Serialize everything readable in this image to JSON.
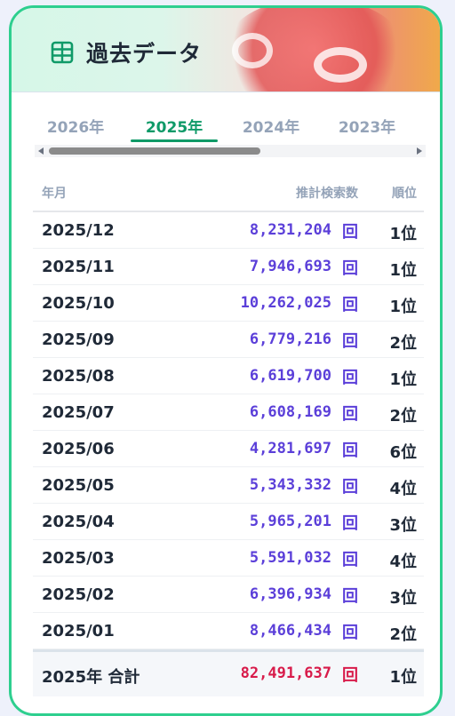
{
  "header": {
    "title": "過去データ",
    "icon": "table-icon",
    "accent": "#0f9a68",
    "border": "#2ecf8f"
  },
  "tabs": [
    {
      "label": "2026年",
      "active": false
    },
    {
      "label": "2025年",
      "active": true
    },
    {
      "label": "2024年",
      "active": false
    },
    {
      "label": "2023年",
      "active": false
    }
  ],
  "table": {
    "headers": {
      "month": "年月",
      "count": "推計検索数",
      "rank": "順位"
    },
    "unit": "回",
    "rows": [
      {
        "month": "2025/12",
        "count": "8,231,204",
        "rank": "1位"
      },
      {
        "month": "2025/11",
        "count": "7,946,693",
        "rank": "1位"
      },
      {
        "month": "2025/10",
        "count": "10,262,025",
        "rank": "1位"
      },
      {
        "month": "2025/09",
        "count": "6,779,216",
        "rank": "2位"
      },
      {
        "month": "2025/08",
        "count": "6,619,700",
        "rank": "1位"
      },
      {
        "month": "2025/07",
        "count": "6,608,169",
        "rank": "2位"
      },
      {
        "month": "2025/06",
        "count": "4,281,697",
        "rank": "6位"
      },
      {
        "month": "2025/05",
        "count": "5,343,332",
        "rank": "4位"
      },
      {
        "month": "2025/04",
        "count": "5,965,201",
        "rank": "3位"
      },
      {
        "month": "2025/03",
        "count": "5,591,032",
        "rank": "4位"
      },
      {
        "month": "2025/02",
        "count": "6,396,934",
        "rank": "3位"
      },
      {
        "month": "2025/01",
        "count": "8,466,434",
        "rank": "2位"
      }
    ],
    "total": {
      "label": "2025年 合計",
      "count": "82,491,637",
      "rank": "1位"
    }
  },
  "colors": {
    "count": "#5b3fd9",
    "total": "#d81b4a"
  }
}
